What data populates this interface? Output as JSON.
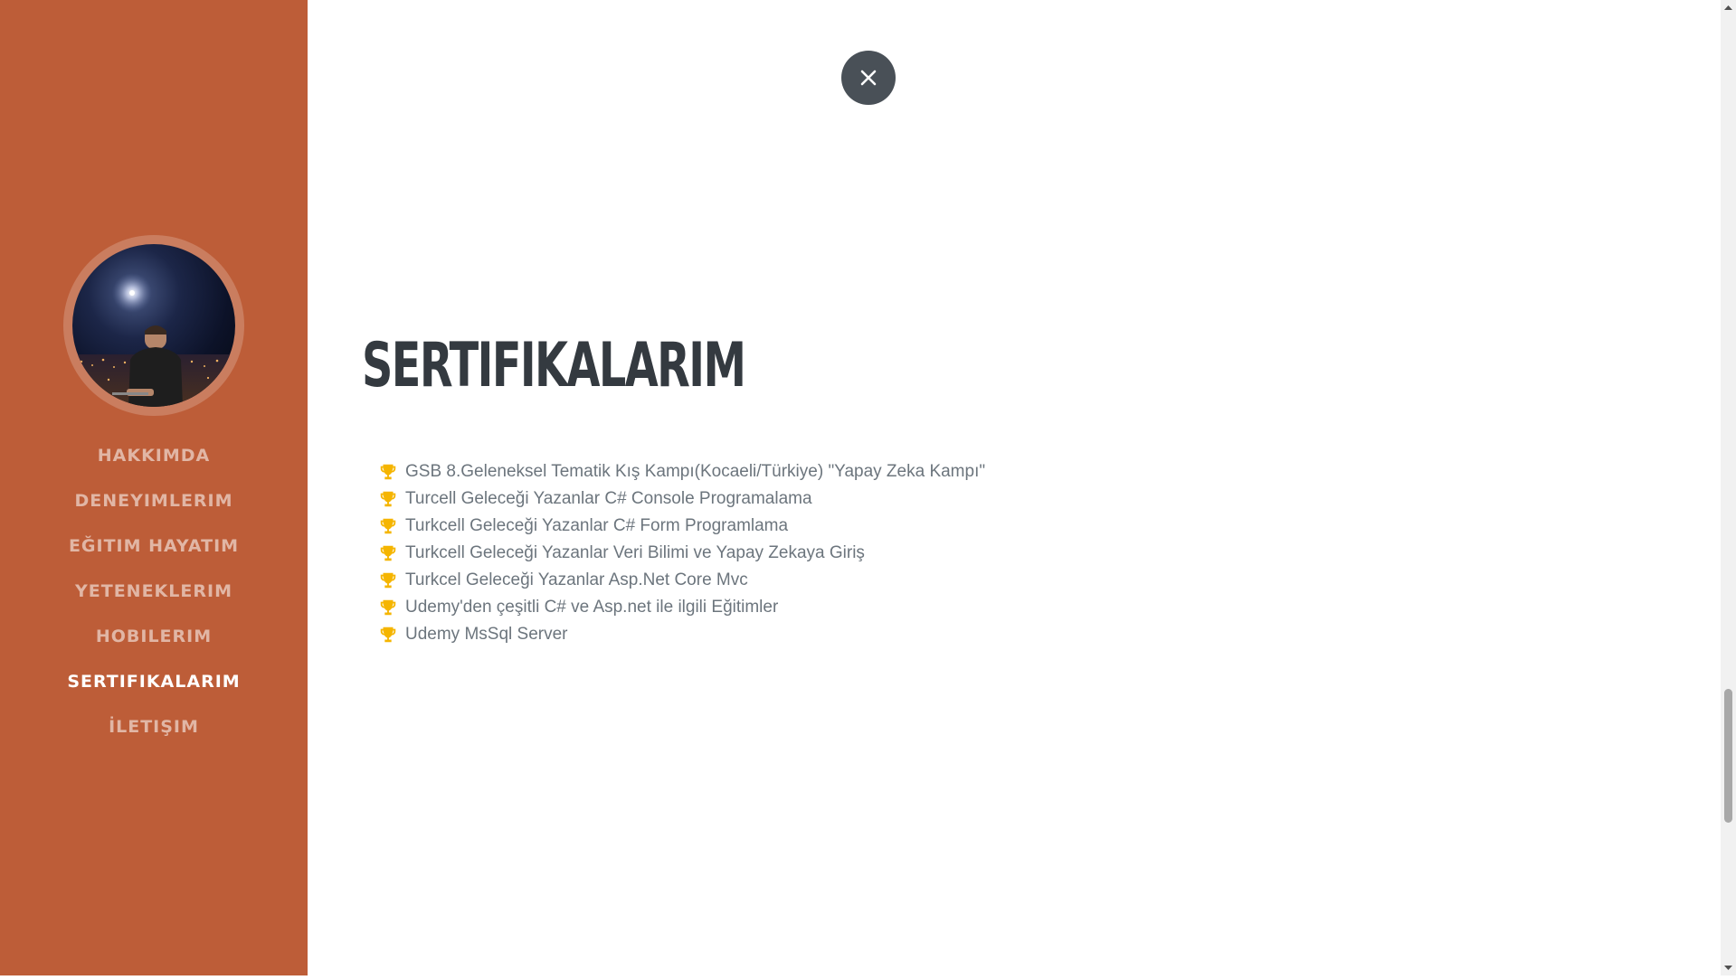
{
  "sidebar": {
    "profile_photo": "profile-photo",
    "nav": [
      {
        "label": "HAKKIMDA",
        "active": false
      },
      {
        "label": "DENEYIMLERIM",
        "active": false
      },
      {
        "label": "EĞITIM HAYATIM",
        "active": false
      },
      {
        "label": "YETENEKLERIM",
        "active": false
      },
      {
        "label": "HOBILERIM",
        "active": false
      },
      {
        "label": "SERTIFIKALARIM",
        "active": true
      },
      {
        "label": "İLETIŞIM",
        "active": false
      }
    ]
  },
  "main": {
    "close_icon": "close-icon",
    "title": "SERTIFIKALARIM",
    "item_icon": "trophy-icon",
    "certificates": [
      "GSB 8.Geleneksel Tematik Kış Kampı(Kocaeli/Türkiye) \"Yapay Zeka Kampı\"",
      "Turcell Geleceği Yazanlar C# Console Programalama",
      "Turkcell Geleceği Yazanlar C# Form Programlama",
      "Turkcell Geleceği Yazanlar Veri Bilimi ve Yapay Zekaya Giriş",
      "Turkcel Geleceği Yazanlar Asp.Net Core Mvc",
      "Udemy'den çeşitli C# ve Asp.net ile ilgili Eğitimler",
      "Udemy MsSql Server"
    ]
  },
  "colors": {
    "sidebar_bg": "#bd5d38",
    "title": "#343a40",
    "text": "#6c757d",
    "trophy": "#f5b500",
    "close_btn": "#495057"
  }
}
